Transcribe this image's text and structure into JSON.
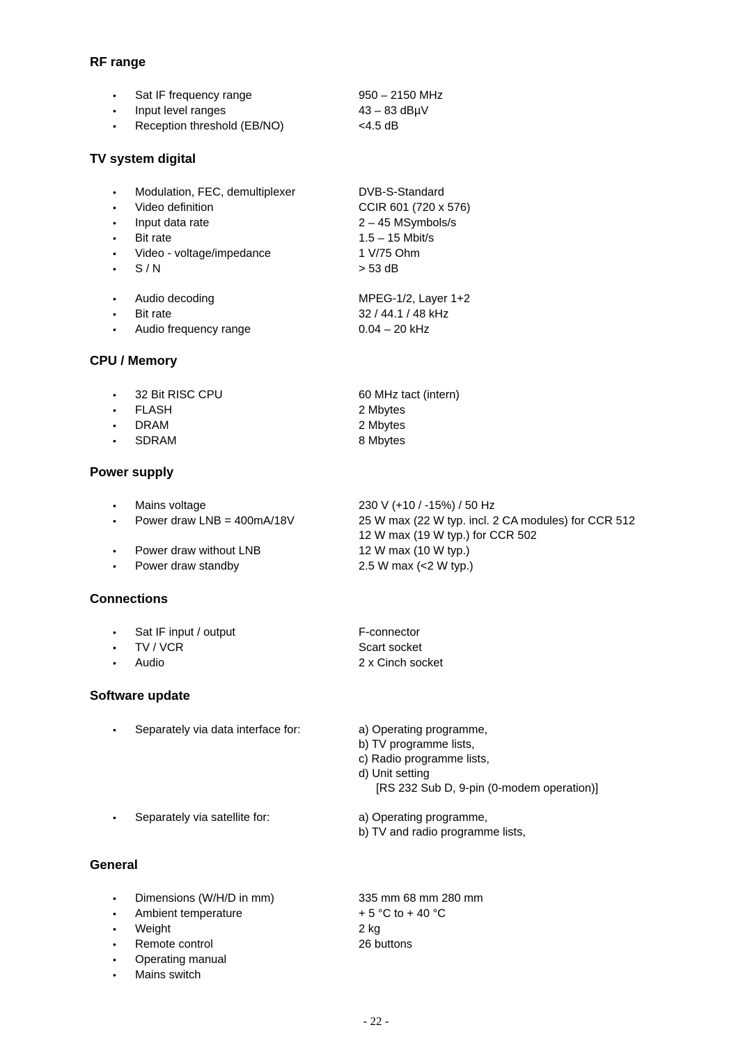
{
  "sections": {
    "rf_range": {
      "title": "RF range",
      "rows": [
        {
          "label": "Sat IF frequency range",
          "value": "950 – 2150 MHz"
        },
        {
          "label": "Input level ranges",
          "value": "43 – 83 dBµV"
        },
        {
          "label": "Reception threshold (EB/NO)",
          "value": "<4.5 dB"
        }
      ]
    },
    "tv_system": {
      "title": "TV system digital",
      "rows": [
        {
          "label": "Modulation, FEC, demultiplexer",
          "value": "DVB-S-Standard"
        },
        {
          "label": "Video definition",
          "value": "CCIR 601 (720 x 576)"
        },
        {
          "label": "Input data rate",
          "value": "2 – 45 MSymbols/s"
        },
        {
          "label": "Bit rate",
          "value": "1.5 – 15 Mbit/s"
        },
        {
          "label": "Video - voltage/impedance",
          "value": "1 V/75 Ohm"
        },
        {
          "label": "S / N",
          "value": "> 53 dB"
        },
        {
          "label": "Audio decoding",
          "value": "MPEG-1/2, Layer 1+2"
        },
        {
          "label": "Bit rate",
          "value": "32 / 44.1 / 48 kHz"
        },
        {
          "label": "Audio frequency range",
          "value": "0.04 – 20 kHz"
        }
      ]
    },
    "cpu_memory": {
      "title": "CPU / Memory",
      "rows": [
        {
          "label": "32 Bit RISC CPU",
          "value": "60 MHz tact (intern)"
        },
        {
          "label": "FLASH",
          "value": "2 Mbytes"
        },
        {
          "label": "DRAM",
          "value": "2 Mbytes"
        },
        {
          "label": "SDRAM",
          "value": "8 Mbytes"
        }
      ]
    },
    "power_supply": {
      "title": "Power supply",
      "rows": [
        {
          "label": "Mains voltage",
          "value": "230 V (+10 / -15%)  /  50 Hz"
        },
        {
          "label": "Power draw LNB = 400mA/18V",
          "value": "25 W max (22 W  typ. incl. 2 CA modules) for CCR 512",
          "value2": "12 W max (19 W typ.) for CCR 502"
        },
        {
          "label": "Power draw without LNB",
          "value": "12 W max (10 W typ.)"
        },
        {
          "label": "Power draw standby",
          "value": "2.5 W max (<2 W typ.)"
        }
      ]
    },
    "connections": {
      "title": "Connections",
      "rows": [
        {
          "label": "Sat IF input / output",
          "value": "F-connector"
        },
        {
          "label": "TV / VCR",
          "value": "Scart socket"
        },
        {
          "label": "Audio",
          "value": "2 x Cinch socket"
        }
      ]
    },
    "software_update": {
      "title": "Software update",
      "rows": [
        {
          "label": "Separately via data interface for:",
          "values": [
            "a)  Operating programme,",
            "b)  TV programme lists,",
            "c)  Radio programme lists,",
            "d)  Unit setting",
            "[RS 232 Sub D, 9-pin (0-modem operation)]"
          ]
        },
        {
          "label": "Separately via satellite for:",
          "values": [
            "a) Operating programme,",
            "b)  TV and radio programme lists,"
          ]
        }
      ]
    },
    "general": {
      "title": "General",
      "rows": [
        {
          "label": "Dimensions (W/H/D in mm)",
          "value": "335 mm 68 mm 280 mm"
        },
        {
          "label": "Ambient temperature",
          "value": "+ 5 °C to + 40 °C"
        },
        {
          "label": "Weight",
          "value": "2 kg"
        },
        {
          "label": "Remote control",
          "value": "26 buttons"
        },
        {
          "label": "Operating manual",
          "value": ""
        },
        {
          "label": "Mains switch",
          "value": ""
        }
      ]
    }
  },
  "bullet_symbol": "•",
  "page_number": "- 22 -"
}
